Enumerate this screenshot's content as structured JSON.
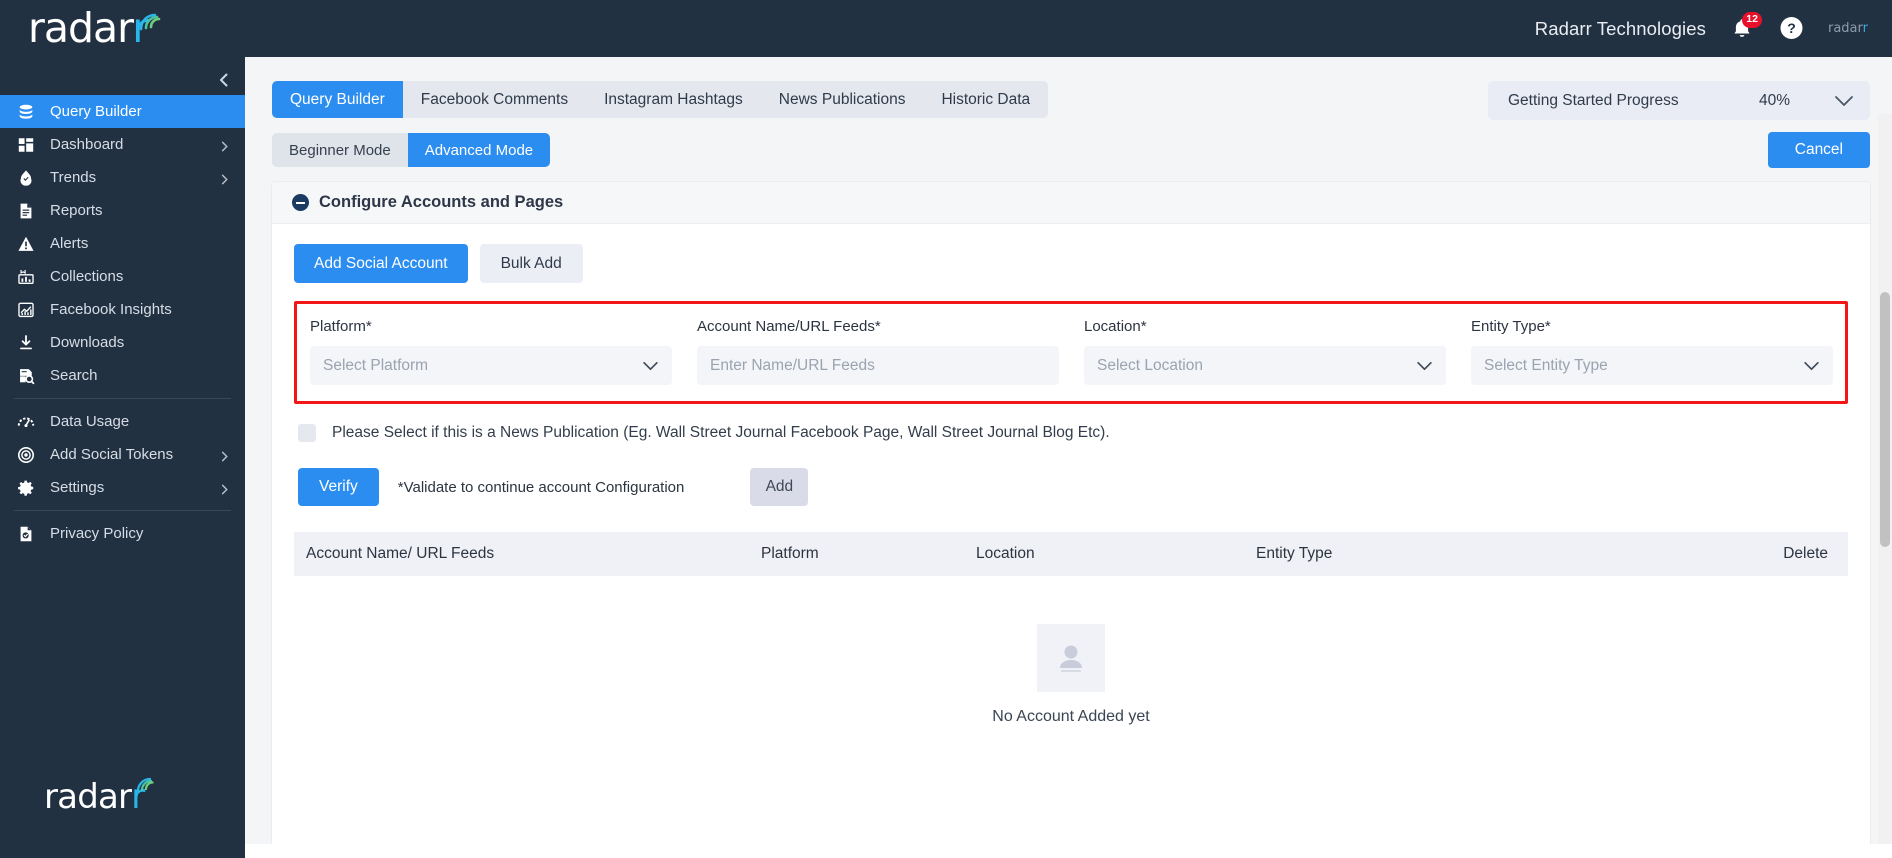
{
  "topbar": {
    "logo_text": "radar",
    "logo_tail": "r",
    "org_name": "Radarr Technologies",
    "notification_count": "12",
    "notification_icon": "bell-icon",
    "help_icon": "help-circle-icon",
    "mini_logo_text": "radar",
    "mini_logo_tail": "r"
  },
  "sidebar": {
    "collapse_icon": "chevron-left-icon",
    "footer_logo_text": "radar",
    "footer_logo_tail": "r",
    "items": [
      {
        "label": "Query Builder",
        "icon": "database-icon",
        "active": true,
        "expandable": false
      },
      {
        "label": "Dashboard",
        "icon": "grid-icon",
        "active": false,
        "expandable": true
      },
      {
        "label": "Trends",
        "icon": "flame-icon",
        "active": false,
        "expandable": true
      },
      {
        "label": "Reports",
        "icon": "document-icon",
        "active": false,
        "expandable": false
      },
      {
        "label": "Alerts",
        "icon": "alert-triangle-icon",
        "active": false,
        "expandable": false
      },
      {
        "label": "Collections",
        "icon": "collections-icon",
        "active": false,
        "expandable": false
      },
      {
        "label": "Facebook Insights",
        "icon": "chart-line-icon",
        "active": false,
        "expandable": false
      },
      {
        "label": "Downloads",
        "icon": "download-icon",
        "active": false,
        "expandable": false
      },
      {
        "label": "Search",
        "icon": "search-doc-icon",
        "active": false,
        "expandable": false
      },
      {
        "label": "Data Usage",
        "icon": "gauge-icon",
        "active": false,
        "expandable": false,
        "divider_before": true
      },
      {
        "label": "Add Social Tokens",
        "icon": "target-icon",
        "active": false,
        "expandable": true
      },
      {
        "label": "Settings",
        "icon": "gear-icon",
        "active": false,
        "expandable": true
      },
      {
        "label": "Privacy Policy",
        "icon": "shield-doc-icon",
        "active": false,
        "expandable": false,
        "divider_before": true
      }
    ]
  },
  "tabs": [
    {
      "label": "Query Builder",
      "active": true
    },
    {
      "label": "Facebook Comments",
      "active": false
    },
    {
      "label": "Instagram Hashtags",
      "active": false
    },
    {
      "label": "News Publications",
      "active": false
    },
    {
      "label": "Historic Data",
      "active": false
    }
  ],
  "progress": {
    "label": "Getting Started Progress",
    "value": "40%",
    "caret_icon": "chevron-down-icon"
  },
  "modes": [
    {
      "label": "Beginner Mode",
      "active": false
    },
    {
      "label": "Advanced Mode",
      "active": true
    }
  ],
  "cancel_button": "Cancel",
  "section": {
    "collapse_icon": "minus-circle-icon",
    "title": "Configure Accounts and Pages",
    "add_social_account": "Add Social Account",
    "bulk_add": "Bulk Add"
  },
  "form": {
    "fields": [
      {
        "label": "Platform*",
        "value": "Select Platform",
        "type": "select",
        "caret_icon": "chevron-down-icon"
      },
      {
        "label": "Account Name/URL Feeds*",
        "value": "Enter Name/URL Feeds",
        "type": "input",
        "caret_icon": ""
      },
      {
        "label": "Location*",
        "value": "Select Location",
        "type": "select",
        "caret_icon": "chevron-down-icon"
      },
      {
        "label": "Entity Type*",
        "value": "Select Entity Type",
        "type": "select",
        "caret_icon": "chevron-down-icon"
      }
    ],
    "highlight_color": "#f31616",
    "news_checkbox_label": "Please Select if this is a News Publication (Eg. Wall Street Journal Facebook Page, Wall Street Journal Blog Etc).",
    "verify_button": "Verify",
    "verify_note": "*Validate to continue account Configuration",
    "add_button": "Add"
  },
  "table": {
    "columns": [
      "Account Name/ URL Feeds",
      "Platform",
      "Location",
      "Entity Type",
      "Delete"
    ],
    "rows": [],
    "empty_icon": "person-placeholder-icon",
    "empty_text": "No Account Added yet"
  },
  "colors": {
    "accent": "#2b8df0",
    "sidebar_bg": "#223142",
    "danger": "#f31616",
    "badge": "#e8102a"
  }
}
